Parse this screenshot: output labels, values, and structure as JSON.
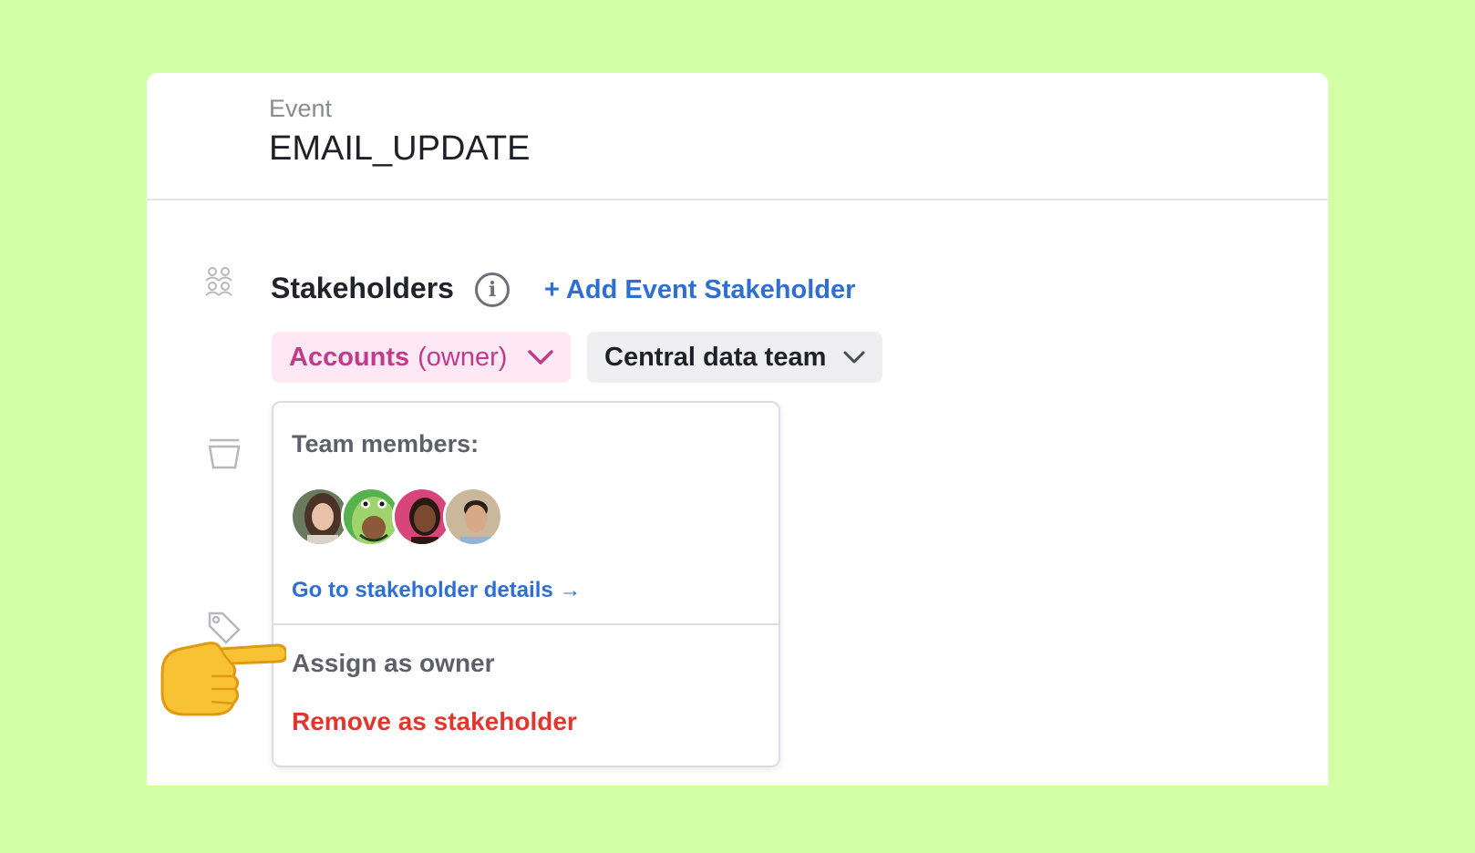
{
  "header": {
    "label": "Event",
    "event_name": "EMAIL_UPDATE"
  },
  "stakeholders": {
    "title": "Stakeholders",
    "info_icon": "info-icon",
    "add_label": "+ Add Event Stakeholder",
    "chips": [
      {
        "name": "Accounts",
        "role": "(owner)",
        "color": "#c23a8a",
        "background": "#fde8f3"
      },
      {
        "name": "Central data team",
        "role": "",
        "color": "#1f1f27",
        "background": "#efeff2"
      }
    ]
  },
  "dropdown": {
    "heading": "Team members:",
    "members": [
      {
        "icon": "avatar-woman-brown-hair"
      },
      {
        "icon": "avatar-avocado"
      },
      {
        "icon": "avatar-woman-pink-background"
      },
      {
        "icon": "avatar-man-smiling"
      }
    ],
    "details_link": "Go to stakeholder details →",
    "assign_label": "Assign as owner",
    "remove_label": "Remove as stakeholder"
  },
  "side_icons": [
    "stakeholders-icon",
    "container-icon",
    "tag-icon"
  ],
  "pointer": "pointing-hand-emoji",
  "colors": {
    "background": "#d3ffa6",
    "link": "#2f6fd1",
    "danger": "#e0362d",
    "owner_accent": "#c23a8a"
  }
}
